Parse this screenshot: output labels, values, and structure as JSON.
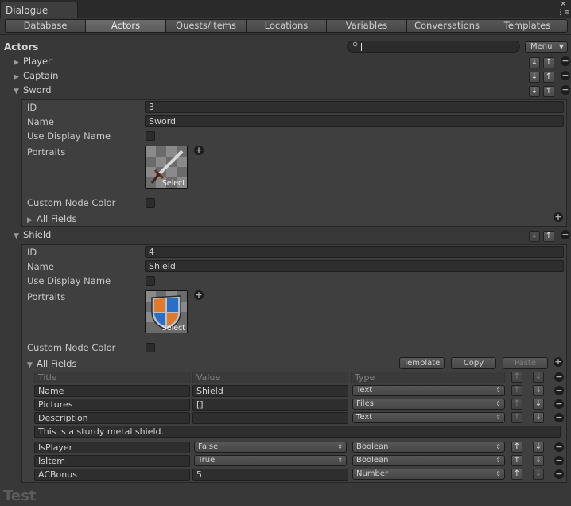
{
  "window": {
    "title": "Dialogue",
    "close_glyph": "✕",
    "menu_glyph": "⋮≡"
  },
  "tabs": [
    {
      "label": "Database"
    },
    {
      "label": "Actors"
    },
    {
      "label": "Quests/Items"
    },
    {
      "label": "Locations"
    },
    {
      "label": "Variables"
    },
    {
      "label": "Conversations"
    },
    {
      "label": "Templates"
    }
  ],
  "active_tab": "Actors",
  "section": {
    "title": "Actors",
    "search_value": "",
    "menu_label": "Menu"
  },
  "actors": [
    {
      "name": "Player",
      "expanded": false
    },
    {
      "name": "Captain",
      "expanded": false
    },
    {
      "name": "Sword",
      "expanded": true
    },
    {
      "name": "Shield",
      "expanded": true
    }
  ],
  "sword": {
    "id_label": "ID",
    "id_value": "3",
    "name_label": "Name",
    "name_value": "Sword",
    "display_label": "Use Display Name",
    "portraits_label": "Portraits",
    "select_label": "Select",
    "node_color_label": "Custom Node Color",
    "all_fields_label": "All Fields"
  },
  "shield": {
    "id_label": "ID",
    "id_value": "4",
    "name_label": "Name",
    "name_value": "Shield",
    "display_label": "Use Display Name",
    "portraits_label": "Portraits",
    "select_label": "Select",
    "node_color_label": "Custom Node Color",
    "all_fields_label": "All Fields",
    "template_btn": "Template",
    "copy_btn": "Copy",
    "paste_btn": "Paste",
    "table": {
      "headers": {
        "title": "Title",
        "value": "Value",
        "type": "Type"
      },
      "rows": [
        {
          "title": "Name",
          "value": "Shield",
          "type": "Text"
        },
        {
          "title": "Pictures",
          "value": "[]",
          "type": "Files"
        },
        {
          "title": "Description",
          "value": "",
          "type": "Text"
        },
        {
          "title": "IsPlayer",
          "value": "False",
          "type": "Boolean"
        },
        {
          "title": "IsItem",
          "value": "True",
          "type": "Boolean"
        },
        {
          "title": "ACBonus",
          "value": "5",
          "type": "Number"
        }
      ],
      "description_text": "This is a sturdy metal shield."
    }
  },
  "footer": {
    "text": "Test"
  },
  "icons": {
    "down": "↓",
    "up": "↑",
    "remove": "−",
    "add": "+",
    "search": "🔍"
  }
}
